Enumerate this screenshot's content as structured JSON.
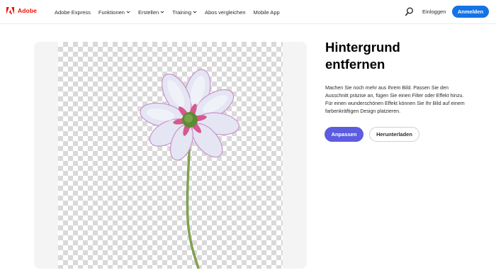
{
  "nav": {
    "brand": "Adobe",
    "links": [
      {
        "label": "Adobe Express",
        "dropdown": false
      },
      {
        "label": "Funktionen",
        "dropdown": true
      },
      {
        "label": "Erstellen",
        "dropdown": true
      },
      {
        "label": "Training",
        "dropdown": true
      },
      {
        "label": "Abos vergleichen",
        "dropdown": false
      },
      {
        "label": "Mobile App",
        "dropdown": false
      }
    ],
    "search_icon": "search-icon",
    "login": "Einloggen",
    "signin": "Anmelden"
  },
  "hero": {
    "headline_line1": "Hintergrund",
    "headline_line2": "entfernen",
    "description": "Machen Sie noch mehr aus Ihrem Bild. Passen Sie den Ausschnitt präzise an, fügen Sie einen Filter oder Effekt hinzu. Für einen wunderschönen Effekt können Sie Ihr Bild auf einem farbenkräftigen Design platzieren.",
    "primary_button": "Anpassen",
    "secondary_button": "Herunterladen"
  },
  "colors": {
    "brand_red": "#eb1000",
    "signin_blue": "#1473e6",
    "primary_purple": "#5c5ce0"
  }
}
